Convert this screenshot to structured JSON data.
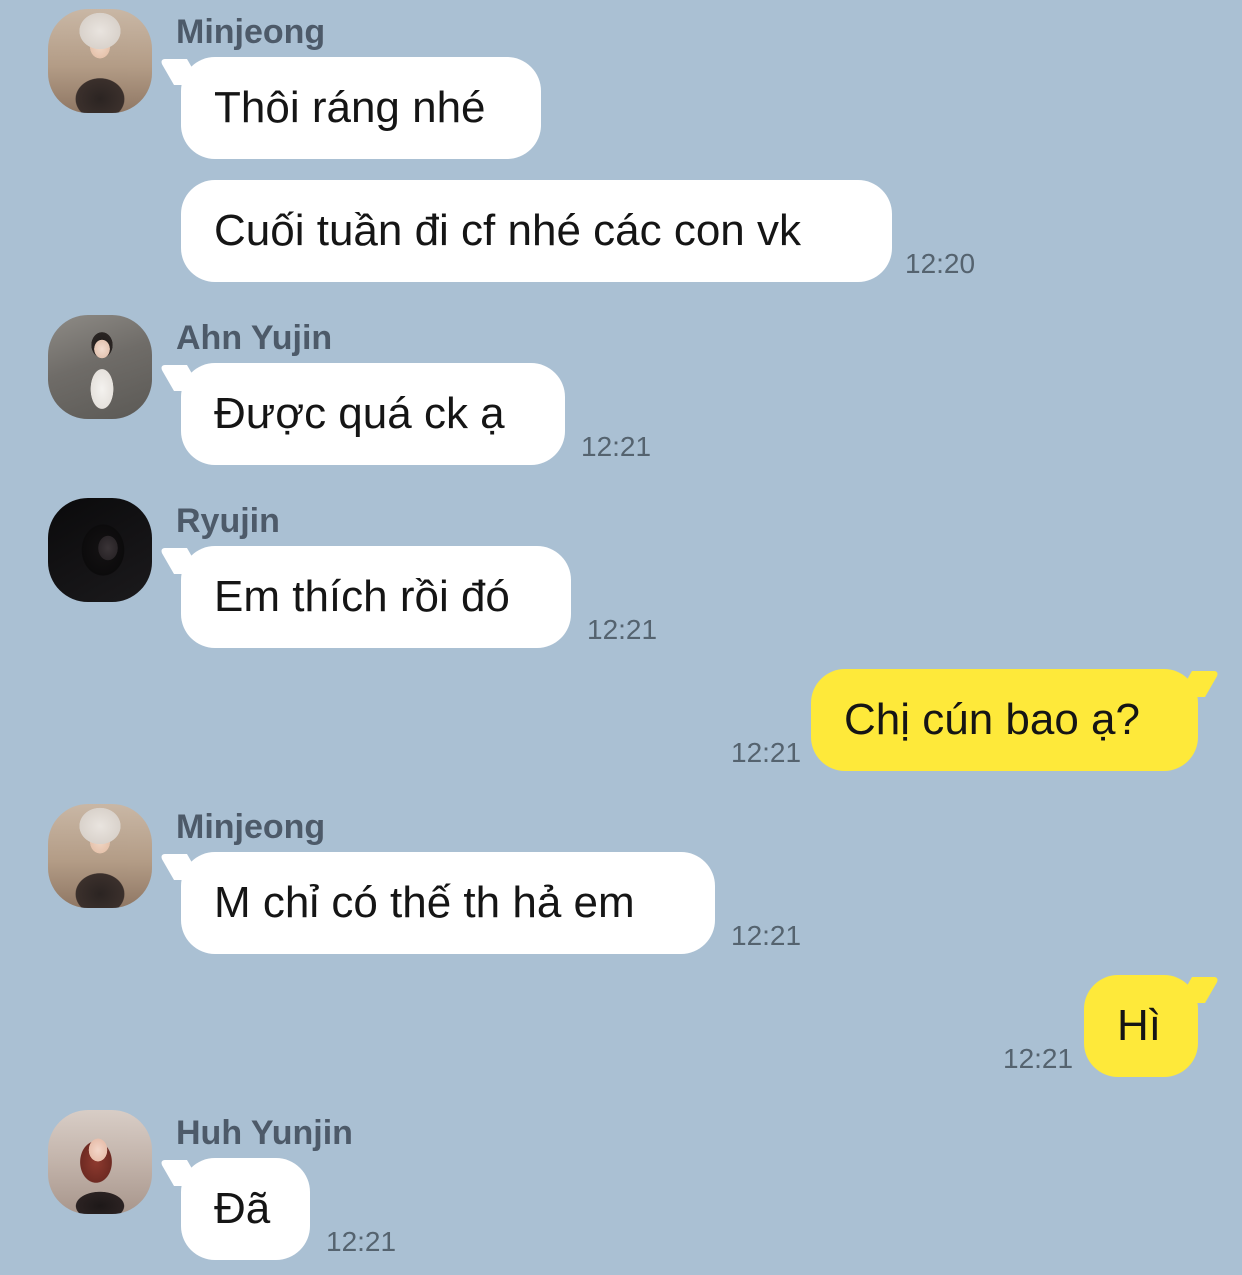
{
  "chat": {
    "messages": [
      {
        "sender": "Minjeong",
        "avatar": "avatar-minjeong",
        "text": "Thôi ráng nhé",
        "time": ""
      },
      {
        "sender": "",
        "avatar": "",
        "text": "Cuối tuần đi cf nhé các con vk",
        "time": "12:20"
      },
      {
        "sender": "Ahn Yujin",
        "avatar": "avatar-yujin",
        "text": "Được quá ck ạ",
        "time": "12:21"
      },
      {
        "sender": "Ryujin",
        "avatar": "avatar-ryujin",
        "text": "Em thích rồi đó",
        "time": "12:21"
      },
      {
        "sender": "me",
        "avatar": "",
        "text": "Chị cún bao ạ?",
        "time": "12:21"
      },
      {
        "sender": "Minjeong",
        "avatar": "avatar-minjeong",
        "text": "M chỉ có thế th hả em",
        "time": "12:21"
      },
      {
        "sender": "me",
        "avatar": "",
        "text": "Hì",
        "time": "12:21"
      },
      {
        "sender": "Huh Yunjin",
        "avatar": "avatar-yunjin",
        "text": "Đã",
        "time": "12:21"
      }
    ]
  },
  "colors": {
    "background": "#aac0d3",
    "incoming_bubble": "#ffffff",
    "outgoing_bubble": "#fee93a",
    "sender_name": "#4d5a69",
    "timestamp": "#55636f"
  }
}
